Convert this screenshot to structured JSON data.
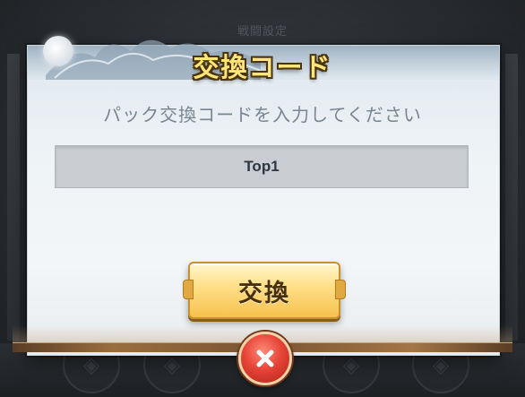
{
  "background": {
    "top_label": "戦闘設定"
  },
  "dialog": {
    "title": "交換コード",
    "instruction": "パック交換コードを入力してください",
    "code_input": {
      "value": "Top1"
    },
    "exchange_button_label": "交換"
  },
  "icons": {
    "close": "close-icon",
    "moon": "moon-icon",
    "mountains": "mountain-icon"
  },
  "colors": {
    "title_fill": "#ffe57a",
    "button_gold": "#f7c24f",
    "close_red": "#e64537"
  }
}
